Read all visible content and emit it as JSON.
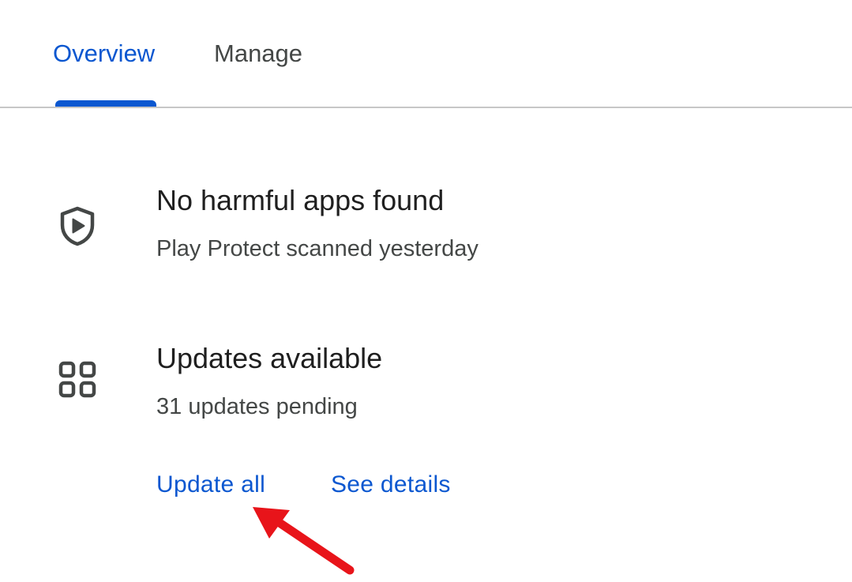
{
  "tabs": [
    {
      "label": "Overview",
      "active": true
    },
    {
      "label": "Manage",
      "active": false
    }
  ],
  "protect": {
    "icon": "shield-play-icon",
    "title": "No harmful apps found",
    "subtitle": "Play Protect scanned yesterday"
  },
  "updates": {
    "icon": "apps-grid-icon",
    "title": "Updates available",
    "subtitle": "31 updates pending",
    "update_all_label": "Update all",
    "see_details_label": "See details"
  },
  "colors": {
    "accent": "#0b57d0",
    "annotation_arrow": "#e8141a",
    "icon": "#444746"
  }
}
